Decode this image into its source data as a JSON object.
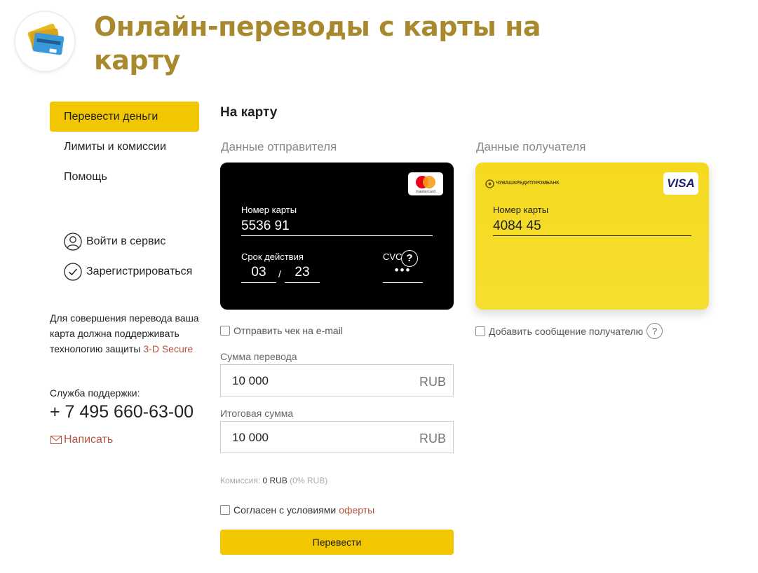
{
  "header": {
    "title": "Онлайн-переводы с карты на карту"
  },
  "sidebar": {
    "items": [
      {
        "label": "Перевести деньги",
        "active": true
      },
      {
        "label": "Лимиты и комиссии"
      },
      {
        "label": "Помощь"
      }
    ],
    "login_label": "Войти в сервис",
    "register_label": "Зарегистрироваться",
    "note_text": "Для совершения перевода ваша карта должна поддерживать технологию защиты",
    "note_link": "3-D Secure",
    "support_label": "Служба поддержки:",
    "phone": "+ 7 495 660-63-00",
    "write_label": "Написать"
  },
  "main": {
    "section_title": "На карту",
    "sender": {
      "column_label": "Данные отправителя",
      "brand": "mastercard",
      "card_number_label": "Номер карты",
      "card_number": "5536 91",
      "expiry_label": "Срок действия",
      "expiry_month": "03",
      "expiry_sep": "/",
      "expiry_year": "23",
      "cvc_label": "CVC",
      "cvc_help": "?",
      "cvc_value": "•••",
      "receipt_checkbox": "Отправить чек на e-mail"
    },
    "receiver": {
      "column_label": "Данные получателя",
      "bank_name": "ЧУВАШКРЕДИТПРОМБАНК",
      "brand": "VISA",
      "card_number_label": "Номер карты",
      "card_number": "4084 45",
      "message_checkbox": "Добавить сообщение получателю",
      "message_help": "?"
    },
    "amount": {
      "label": "Сумма перевода",
      "value": "10 000",
      "currency": "RUB"
    },
    "total": {
      "label": "Итоговая сумма",
      "value": "10 000",
      "currency": "RUB"
    },
    "commission": {
      "label": "Комиссия:",
      "value": "0 RUB",
      "percent": "(0% RUB)"
    },
    "agree": {
      "text": "Согласен с условиями",
      "link": "оферты"
    },
    "submit_label": "Перевести"
  },
  "colors": {
    "accent": "#f2c600",
    "title": "#a9892e",
    "link": "#b5523a",
    "receiver_card": "#f5d920",
    "sender_card": "#000000"
  }
}
